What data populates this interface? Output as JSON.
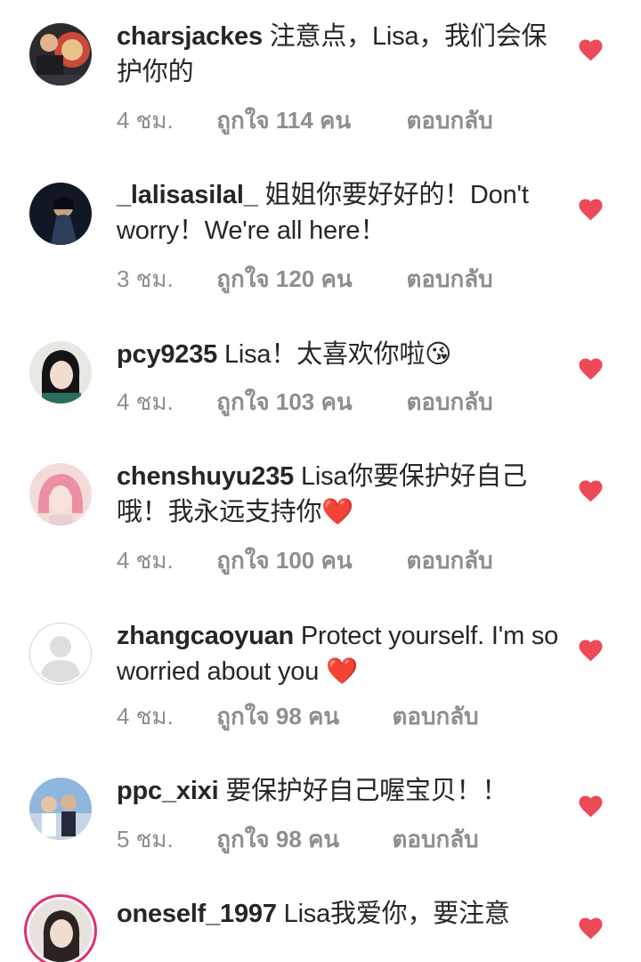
{
  "colors": {
    "text": "#262626",
    "meta": "#8e8e8e",
    "heart": "#ed4956",
    "story_ring": "#e1306c"
  },
  "comments": [
    {
      "username": "charsjackes",
      "text": "注意点，Lisa，我们会保护你的",
      "time": "4 ชม.",
      "likes": "ถูกใจ 114 คน",
      "reply": "ตอบกลับ",
      "avatar": "avatar-photo",
      "liked_icon": "heart-filled-icon"
    },
    {
      "username": "_lalisasilal_",
      "text": "姐姐你要好好的！Don't worry！We're all here！",
      "time": "3 ชม.",
      "likes": "ถูกใจ 120 คน",
      "reply": "ตอบกลับ",
      "avatar": "avatar-photo",
      "liked_icon": "heart-filled-icon"
    },
    {
      "username": "pcy9235",
      "text": "Lisa！太喜欢你啦😘",
      "time": "4 ชม.",
      "likes": "ถูกใจ 103 คน",
      "reply": "ตอบกลับ",
      "avatar": "avatar-photo",
      "liked_icon": "heart-filled-icon"
    },
    {
      "username": "chenshuyu235",
      "text": "Lisa你要保护好自己哦！我永远支持你❤️",
      "time": "4 ชม.",
      "likes": "ถูกใจ 100 คน",
      "reply": "ตอบกลับ",
      "avatar": "avatar-photo",
      "liked_icon": "heart-filled-icon"
    },
    {
      "username": "zhangcaoyuan",
      "text": "Protect yourself. I'm so worried about you ❤️",
      "time": "4 ชม.",
      "likes": "ถูกใจ 98 คน",
      "reply": "ตอบกลับ",
      "avatar": "default-avatar-icon",
      "liked_icon": "heart-filled-icon"
    },
    {
      "username": "ppc_xixi",
      "text": "要保护好自己喔宝贝！！",
      "time": "5 ชม.",
      "likes": "ถูกใจ 98 คน",
      "reply": "ตอบกลับ",
      "avatar": "avatar-photo",
      "liked_icon": "heart-filled-icon"
    },
    {
      "username": "oneself_1997",
      "text": "Lisa我爱你，要注意",
      "avatar": "avatar-photo-story-ring",
      "liked_icon": "heart-filled-icon"
    }
  ]
}
